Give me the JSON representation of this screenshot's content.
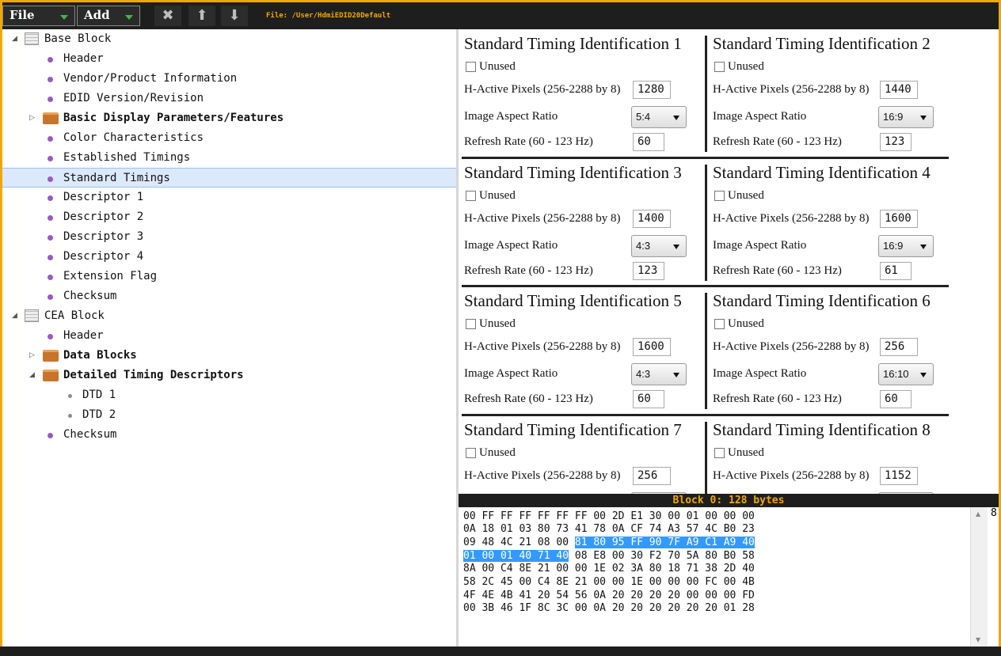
{
  "toolbar": {
    "file_label": "File",
    "add_label": "Add",
    "delete_icon": "close-icon",
    "up_icon": "arrow-up-icon",
    "down_icon": "arrow-down-icon",
    "file_path": "File: /User/HdmiEDID20Default"
  },
  "tree": {
    "base_block": "Base Block",
    "base_items": [
      "Header",
      "Vendor/Product Information",
      "EDID Version/Revision"
    ],
    "basic_display": "Basic Display Parameters/Features",
    "base_items2": [
      "Color Characteristics",
      "Established Timings",
      "Standard Timings",
      "Descriptor 1",
      "Descriptor 2",
      "Descriptor 3",
      "Descriptor 4",
      "Extension Flag",
      "Checksum"
    ],
    "cea_block": "CEA Block",
    "cea_header": "Header",
    "data_blocks": "Data Blocks",
    "dtd_group": "Detailed Timing Descriptors",
    "dtd_items": [
      "DTD 1",
      "DTD 2"
    ],
    "cea_checksum": "Checksum",
    "selected": "Standard Timings"
  },
  "labels": {
    "unused": "Unused",
    "h_active": "H-Active Pixels (256-2288 by 8)",
    "aspect": "Image Aspect Ratio",
    "refresh": "Refresh Rate (60 - 123 Hz)"
  },
  "timings": [
    {
      "title": "Standard Timing Identification 1",
      "h_active": "1280",
      "aspect": "5:4",
      "refresh": "60"
    },
    {
      "title": "Standard Timing Identification 2",
      "h_active": "1440",
      "aspect": "16:9",
      "refresh": "123"
    },
    {
      "title": "Standard Timing Identification 3",
      "h_active": "1400",
      "aspect": "4:3",
      "refresh": "123"
    },
    {
      "title": "Standard Timing Identification 4",
      "h_active": "1600",
      "aspect": "16:9",
      "refresh": "61"
    },
    {
      "title": "Standard Timing Identification 5",
      "h_active": "1600",
      "aspect": "4:3",
      "refresh": "60"
    },
    {
      "title": "Standard Timing Identification 6",
      "h_active": "256",
      "aspect": "16:10",
      "refresh": "60"
    },
    {
      "title": "Standard Timing Identification 7",
      "h_active": "256",
      "aspect": "",
      "refresh": ""
    },
    {
      "title": "Standard Timing Identification 8",
      "h_active": "1152",
      "aspect": "",
      "refresh": ""
    }
  ],
  "hex": {
    "header": "Block 0: 128 bytes",
    "lines": [
      {
        "pre": "00 FF FF FF FF FF FF 00 2D E1 30 00 01 00 00 00",
        "hl": "",
        "post": ""
      },
      {
        "pre": "0A 18 01 03 80 73 41 78 0A CF 74 A3 57 4C B0 23",
        "hl": "",
        "post": ""
      },
      {
        "pre": "09 48 4C 21 08 00 ",
        "hl": "81 80 95 FF 90 7F A9 C1 A9 40",
        "post": ""
      },
      {
        "pre": "",
        "hl": "01 00 01 40 71 40",
        "post": " 08 E8 00 30 F2 70 5A 80 B0 58"
      },
      {
        "pre": "8A 00 C4 8E 21 00 00 1E 02 3A 80 18 71 38 2D 40",
        "hl": "",
        "post": ""
      },
      {
        "pre": "58 2C 45 00 C4 8E 21 00 00 1E 00 00 00 FC 00 4B",
        "hl": "",
        "post": ""
      },
      {
        "pre": "4F 4E 4B 41 20 54 56 0A 20 20 20 20 00 00 00 FD",
        "hl": "",
        "post": ""
      },
      {
        "pre": "00 3B 46 1F 8C 3C 00 0A 20 20 20 20 20 20 01 28",
        "hl": "",
        "post": ""
      }
    ],
    "side_value": "8"
  }
}
